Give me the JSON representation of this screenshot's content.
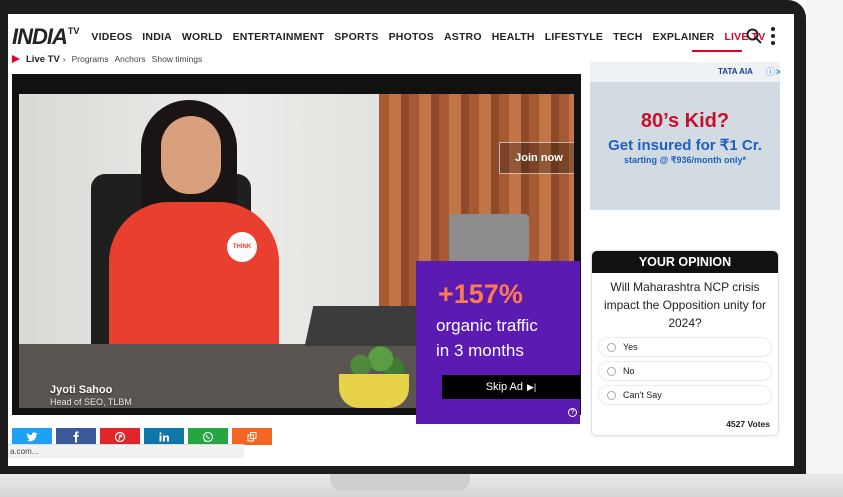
{
  "nav": {
    "logo_main": "INDIA",
    "logo_tv": "TV",
    "items": [
      {
        "label": "VIDEOS"
      },
      {
        "label": "INDIA"
      },
      {
        "label": "WORLD"
      },
      {
        "label": "ENTERTAINMENT"
      },
      {
        "label": "SPORTS"
      },
      {
        "label": "PHOTOS"
      },
      {
        "label": "ASTRO"
      },
      {
        "label": "HEALTH"
      },
      {
        "label": "LIFESTYLE"
      },
      {
        "label": "TECH"
      },
      {
        "label": "EXPLAINER"
      },
      {
        "label": "LIVE TV"
      }
    ],
    "accent_color": "#e4002b"
  },
  "live_strip": {
    "title": "Live TV",
    "links": [
      "Programs",
      "Anchors",
      "Show timings"
    ]
  },
  "video": {
    "speaker_name": "Jyoti Sahoo",
    "speaker_role": "Head of SEO, TLBM",
    "shirt_badge": "THINK LITTLE BIG",
    "join_label": "Join now",
    "promo": {
      "big": "+157%",
      "line1": "organic traffic",
      "line2": "in 3 months",
      "skip_label": "Skip Ad",
      "skip_icon": "skip-next-icon",
      "info_icon": "info-icon",
      "bg_color": "#5b1bb2",
      "highlight_color": "#ff7a4d"
    }
  },
  "share": {
    "buttons": [
      {
        "name": "twitter",
        "color": "#1da1f2"
      },
      {
        "name": "facebook",
        "color": "#3b5998"
      },
      {
        "name": "pinterest",
        "color": "#e2252b"
      },
      {
        "name": "linkedin",
        "color": "#0e76a8"
      },
      {
        "name": "whatsapp",
        "color": "#25a643"
      },
      {
        "name": "copy",
        "color": "#f26522"
      }
    ]
  },
  "status_bar": {
    "text": "a.com..."
  },
  "ad": {
    "brand": "TATA AIA",
    "headline": "80’s Kid?",
    "sub": "Get insured for ₹1 Cr.",
    "small": "starting @ ₹936/month only*"
  },
  "poll": {
    "heading": "YOUR OPINION",
    "question": "Will Maharashtra NCP crisis impact the Opposition unity for 2024?",
    "options": [
      "Yes",
      "No",
      "Can't Say"
    ],
    "votes": "4527 Votes"
  }
}
